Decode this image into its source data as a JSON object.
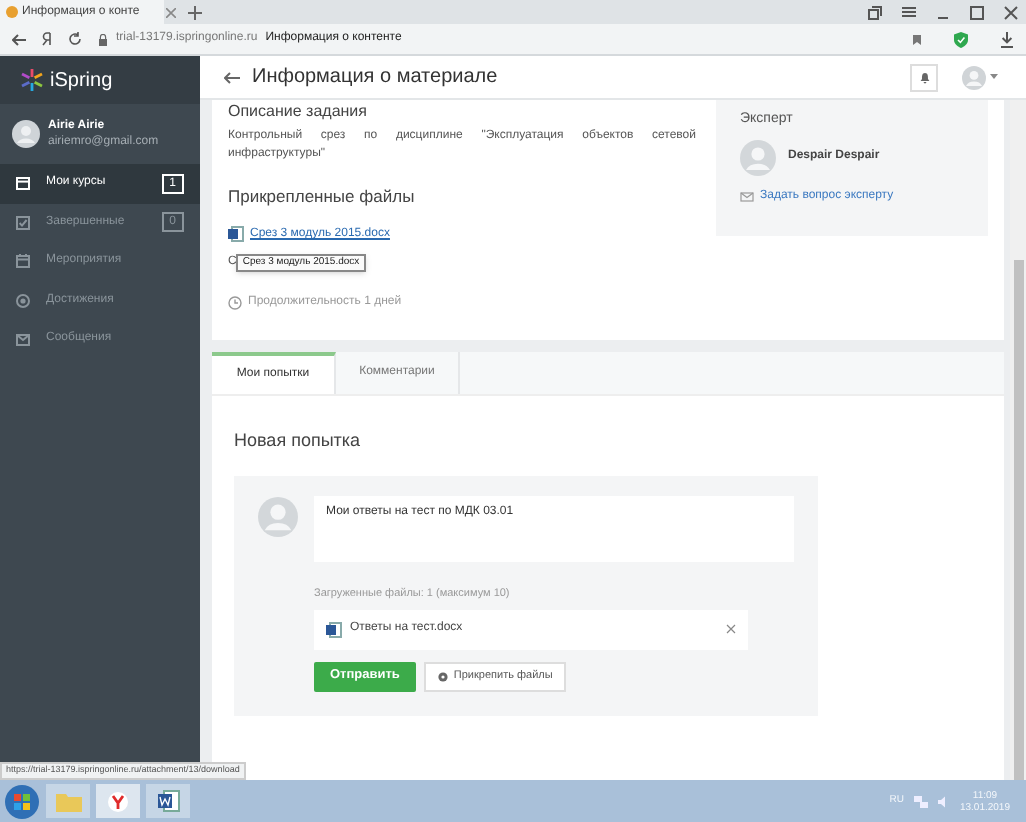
{
  "browser": {
    "tab_title": "Информация о конте",
    "url_host": "trial-13179.ispringonline.ru",
    "page_title": "Информация о контенте"
  },
  "sidebar": {
    "logo": "iSpring",
    "user": {
      "name": "Airie Airie",
      "email": "airiemro@gmail.com"
    },
    "items": [
      {
        "label": "Мои курсы",
        "count": "1",
        "selected": true
      },
      {
        "label": "Завершенные",
        "count": "0",
        "selected": false
      },
      {
        "label": "Мероприятия",
        "selected": false
      },
      {
        "label": "Достижения",
        "selected": false
      },
      {
        "label": "Сообщения",
        "selected": false
      }
    ]
  },
  "header": {
    "title": "Информация о материале"
  },
  "task": {
    "heading": "Описание задания",
    "description": "Контрольный срез по дисциплине \"Эксплуатация объектов сетевой инфраструктуры\"",
    "files_heading": "Прикрепленные файлы",
    "file_link": "Срез 3 модуль 2015.docx",
    "covered_text": "С",
    "tooltip": "Срез 3 модуль 2015.docx",
    "duration": "Продолжительность 1 дней"
  },
  "expert": {
    "heading": "Эксперт",
    "name": "Despair Despair",
    "ask_link": "Задать вопрос эксперту"
  },
  "tabs": [
    {
      "label": "Мои попытки",
      "selected": true
    },
    {
      "label": "Комментарии",
      "selected": false
    }
  ],
  "attempt": {
    "heading": "Новая попытка",
    "answer": "Мои ответы на тест по МДК 03.01",
    "uploaded_label": "Загруженные файлы: 1 (максимум 10)",
    "uploaded_file": "Ответы на тест.docx",
    "submit": "Отправить",
    "attach": "Прикрепить файлы"
  },
  "status_url": "https://trial-13179.ispringonline.ru/attachment/13/download",
  "taskbar": {
    "language": "RU",
    "time": "11:09",
    "date": "13.01.2019"
  }
}
